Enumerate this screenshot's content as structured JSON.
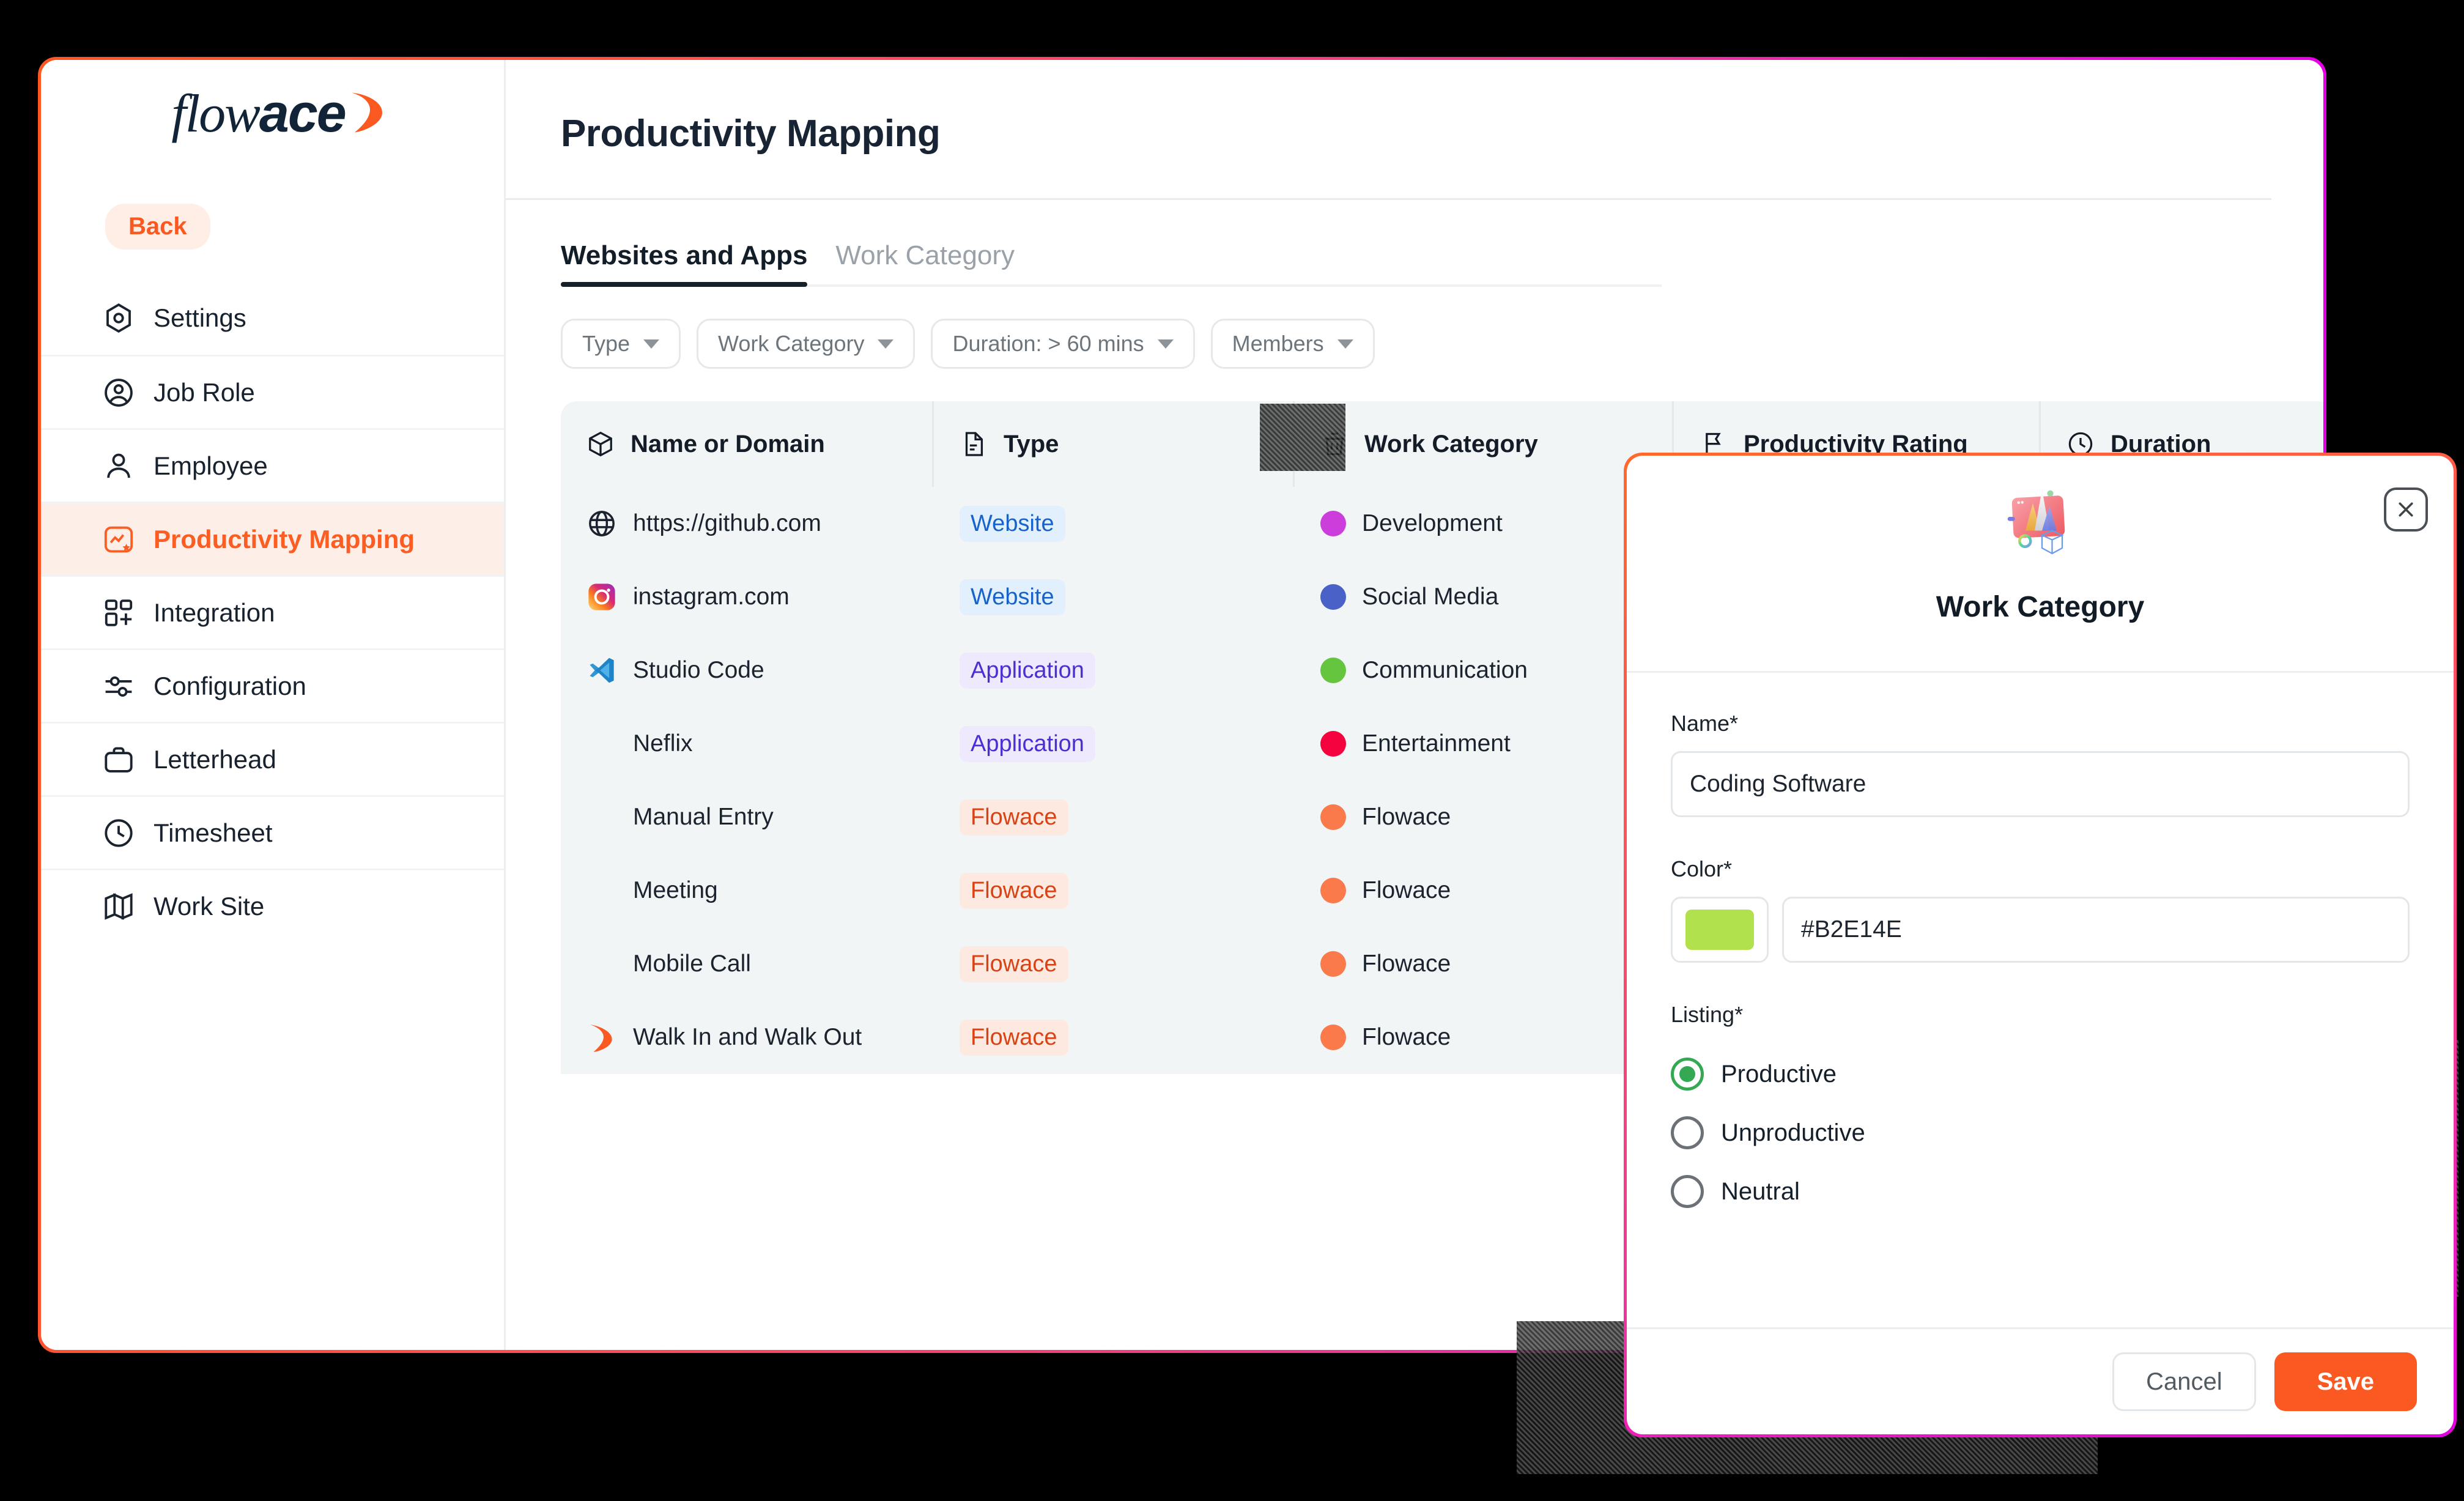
{
  "sidebar": {
    "logo": {
      "part1": "flow",
      "part2": "ace",
      "swoosh_color": "#FA5A21"
    },
    "back_label": "Back",
    "items": [
      {
        "label": "Settings",
        "icon": "gear-hexagon-icon",
        "active": false
      },
      {
        "label": "Job Role",
        "icon": "user-circle-icon",
        "active": false
      },
      {
        "label": "Employee",
        "icon": "user-icon",
        "active": false
      },
      {
        "label": "Productivity Mapping",
        "icon": "chart-star-icon",
        "active": true
      },
      {
        "label": "Integration",
        "icon": "grid-plus-icon",
        "active": false
      },
      {
        "label": "Configuration",
        "icon": "sliders-icon",
        "active": false
      },
      {
        "label": "Letterhead",
        "icon": "briefcase-icon",
        "active": false
      },
      {
        "label": "Timesheet",
        "icon": "clock-icon",
        "active": false
      },
      {
        "label": "Work Site",
        "icon": "map-icon",
        "active": false
      }
    ]
  },
  "main": {
    "page_title": "Productivity Mapping",
    "tabs": [
      {
        "label": "Websites and Apps",
        "active": true
      },
      {
        "label": "Work Category",
        "active": false
      }
    ],
    "filters": [
      {
        "label": "Type"
      },
      {
        "label": "Work Category"
      },
      {
        "label": "Duration: > 60 mins"
      },
      {
        "label": "Members"
      }
    ],
    "table": {
      "columns": [
        {
          "label": "Name or Domain",
          "icon": "box-3d-icon"
        },
        {
          "label": "Type",
          "icon": "document-icon"
        },
        {
          "label": "Work Category",
          "icon": "basket-icon"
        },
        {
          "label": "Productivity Rating",
          "icon": "flag-icon"
        },
        {
          "label": "Duration",
          "icon": "clock-icon"
        }
      ],
      "rows": [
        {
          "name": "https://github.com",
          "icon": "globe-icon",
          "type": "Website",
          "type_style": "website",
          "category": "Development",
          "dot_color": "#CC3EDB"
        },
        {
          "name": "instagram.com",
          "icon": "instagram-icon",
          "type": "Website",
          "type_style": "website",
          "category": "Social Media",
          "dot_color": "#4A62C8"
        },
        {
          "name": "Studio Code",
          "icon": "vscode-icon",
          "type": "Application",
          "type_style": "application",
          "category": "Communication",
          "dot_color": "#66C53F"
        },
        {
          "name": "Neflix",
          "icon": "none",
          "type": "Application",
          "type_style": "application",
          "category": "Entertainment",
          "dot_color": "#F5033E"
        },
        {
          "name": "Manual Entry",
          "icon": "none",
          "type": "Flowace",
          "type_style": "flowace",
          "category": "Flowace",
          "dot_color": "#FA7A4B"
        },
        {
          "name": "Meeting",
          "icon": "none",
          "type": "Flowace",
          "type_style": "flowace",
          "category": "Flowace",
          "dot_color": "#FA7A4B"
        },
        {
          "name": "Mobile Call",
          "icon": "none",
          "type": "Flowace",
          "type_style": "flowace",
          "category": "Flowace",
          "dot_color": "#FA7A4B"
        },
        {
          "name": "Walk In and Walk Out",
          "icon": "flowace-icon",
          "type": "Flowace",
          "type_style": "flowace",
          "category": "Flowace",
          "dot_color": "#FA7A4B"
        }
      ]
    }
  },
  "modal": {
    "title": "Work Category",
    "close_icon": "close-icon",
    "illustration": "work-category-illustration",
    "name_label": "Name*",
    "name_value": "Coding Software",
    "color_label": "Color*",
    "color_value": "#B2E14E",
    "listing_label": "Listing*",
    "listing_options": [
      {
        "label": "Productive",
        "checked": true
      },
      {
        "label": "Unproductive",
        "checked": false
      },
      {
        "label": "Neutral",
        "checked": false
      }
    ],
    "cancel_label": "Cancel",
    "save_label": "Save",
    "accent_color": "#FA5A21"
  }
}
